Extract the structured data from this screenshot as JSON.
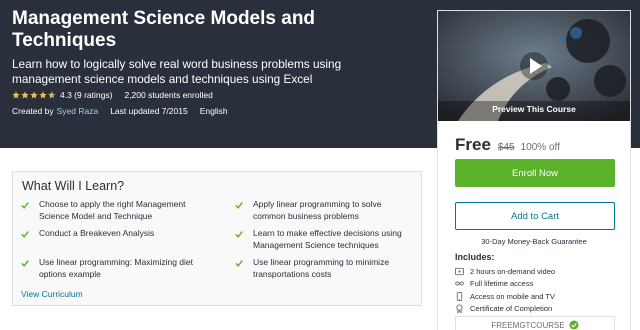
{
  "course": {
    "title": "Management Science Models and Techniques",
    "subtitle": "Learn how to logically solve real word business problems using management science models and techniques using Excel",
    "rating_text": "4.3 (9 ratings)",
    "rating_value": 4.3,
    "students": "2,200 students enrolled",
    "created_by_label": "Created by",
    "instructor": "Syed Raza",
    "updated": "Last updated 7/2015",
    "language": "English"
  },
  "sidebar": {
    "preview_label": "Preview This Course",
    "price": "Free",
    "old_price": "$45",
    "discount": "100% off",
    "enroll_label": "Enroll Now",
    "cart_label": "Add to Cart",
    "guarantee": "30-Day Money-Back Guarantee",
    "includes_title": "Includes:",
    "includes": [
      {
        "icon": "video-icon",
        "text": "2 hours on-demand video"
      },
      {
        "icon": "infinity-icon",
        "text": "Full lifetime access"
      },
      {
        "icon": "mobile-icon",
        "text": "Access on mobile and TV"
      },
      {
        "icon": "certificate-icon",
        "text": "Certificate of Completion"
      }
    ],
    "coupon_code": "FREEMGTCOURSE"
  },
  "learn": {
    "title": "What Will I Learn?",
    "items": [
      "Choose to apply the right Management Science Model and Technique",
      "Apply linear programming to solve common business problems",
      "Conduct a Breakeven Analysis",
      "Learn to make effective decisions using Management Science techniques",
      "Use linear programming: Maximizing diet options example",
      "Use linear programming to minimize transportations costs"
    ],
    "view_link": "View Curriculum"
  },
  "colors": {
    "hero_bg": "#29303b",
    "accent_green": "#5ab32a",
    "link_blue": "#007791",
    "star_gold": "#f4c150"
  }
}
